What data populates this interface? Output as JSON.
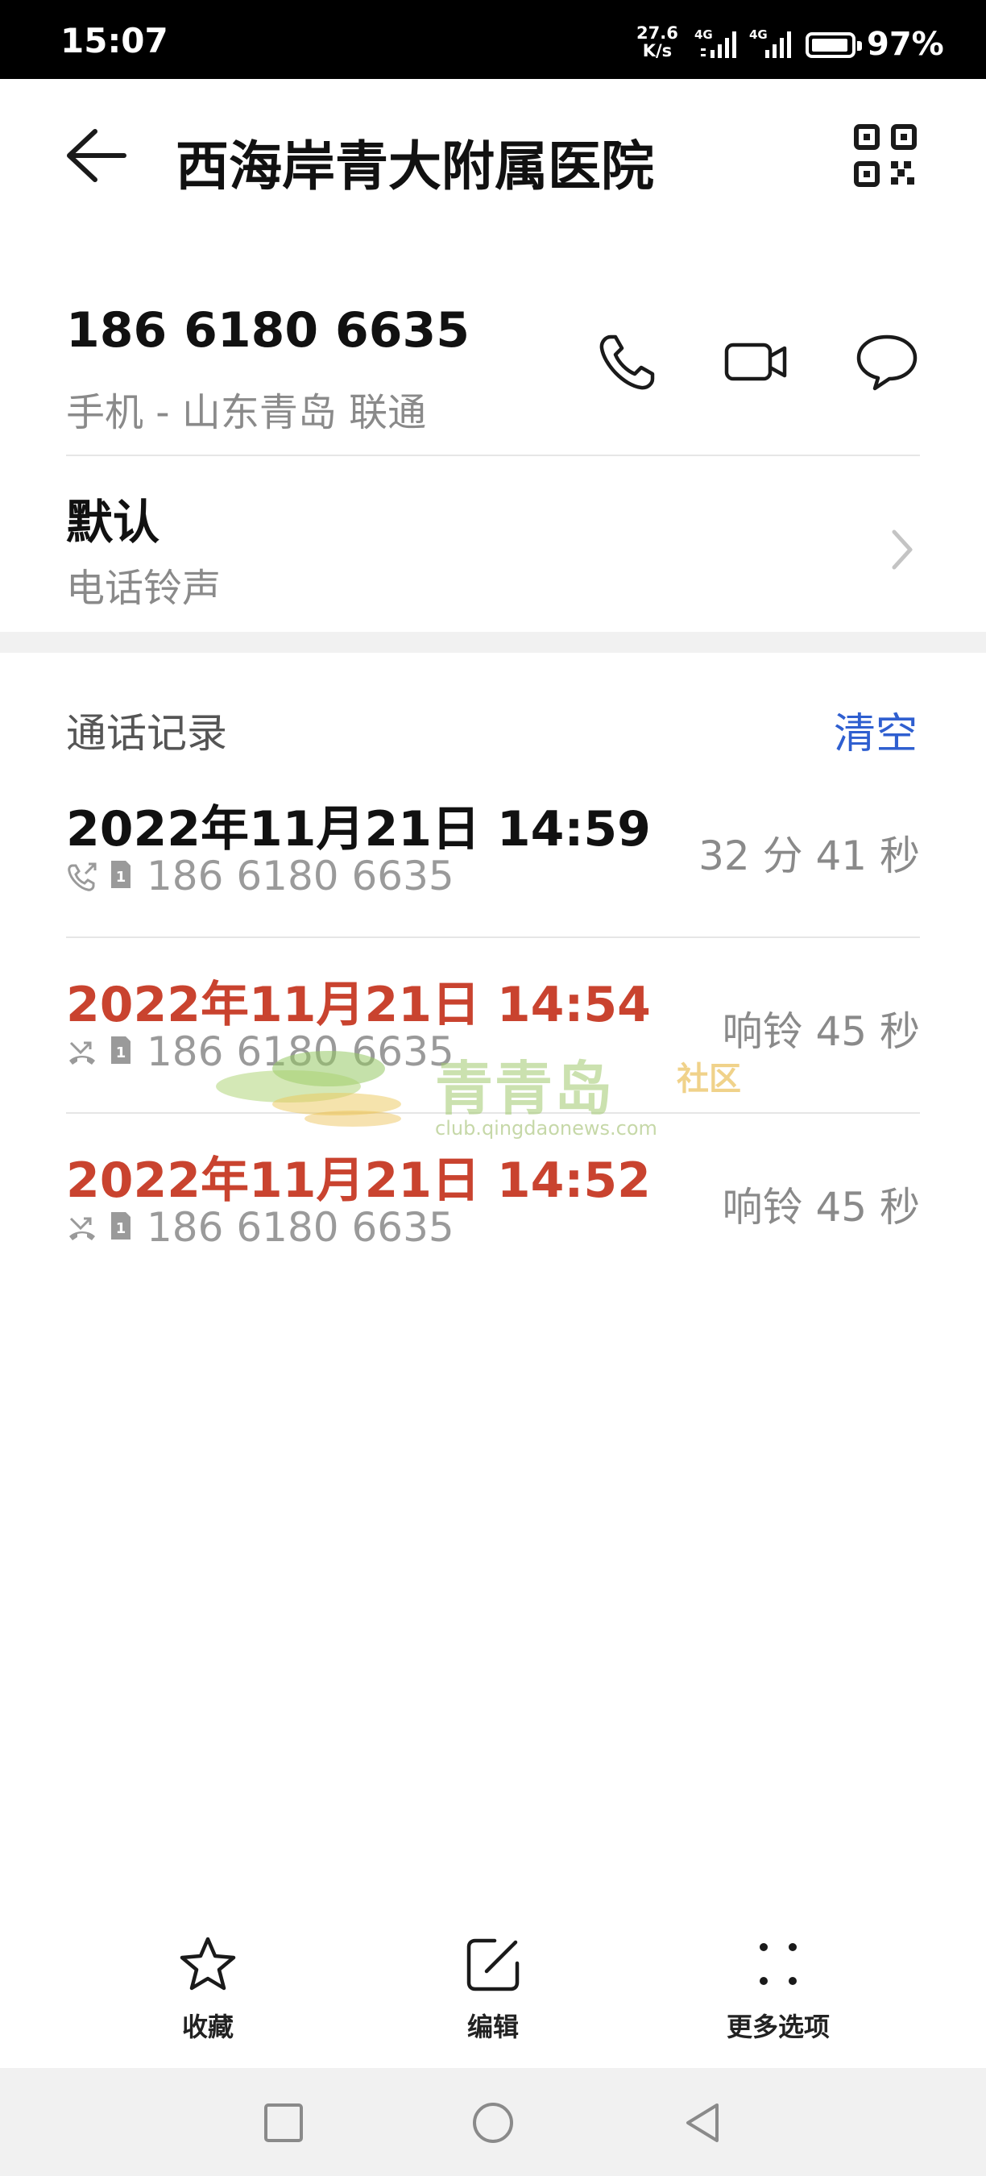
{
  "status_bar": {
    "time": "15:07",
    "speed_value": "27.6",
    "speed_unit": "K/s",
    "net1": "4G",
    "net2": "4G",
    "battery": "97%"
  },
  "header": {
    "title": "西海岸青大附属医院"
  },
  "contact": {
    "phone": "186 6180 6635",
    "phone_desc": "手机 - 山东青岛 联通",
    "ringtone_value": "默认",
    "ringtone_label": "电话铃声"
  },
  "call_log": {
    "header": "通话记录",
    "clear_label": "清空",
    "entries": [
      {
        "date": "2022年11月21日 14:59",
        "number": "186 6180 6635",
        "duration": "32 分 41 秒",
        "type": "outgoing"
      },
      {
        "date": "2022年11月21日 14:54",
        "number": "186 6180 6635",
        "duration": "响铃 45 秒",
        "type": "missed"
      },
      {
        "date": "2022年11月21日 14:52",
        "number": "186 6180 6635",
        "duration": "响铃 45 秒",
        "type": "missed"
      }
    ]
  },
  "watermark": {
    "name": "青青岛",
    "tag": "社区",
    "url": "club.qingdaonews.com"
  },
  "toolbar": {
    "favorite_label": "收藏",
    "edit_label": "编辑",
    "more_label": "更多选项"
  },
  "icons": {
    "back": "arrow-left-icon",
    "qr": "qr-code-icon",
    "call": "phone-icon",
    "video": "video-camera-icon",
    "message": "message-bubble-icon",
    "chevron": "chevron-right-icon",
    "outgoing": "outgoing-call-icon",
    "missed": "missed-call-icon",
    "sim": "sim-card-icon",
    "favorite": "star-icon",
    "edit": "edit-icon",
    "more": "more-dots-icon"
  },
  "colors": {
    "accent": "#2f5fd0",
    "missed": "#c9432f",
    "secondary_text": "#8a8a8a"
  }
}
